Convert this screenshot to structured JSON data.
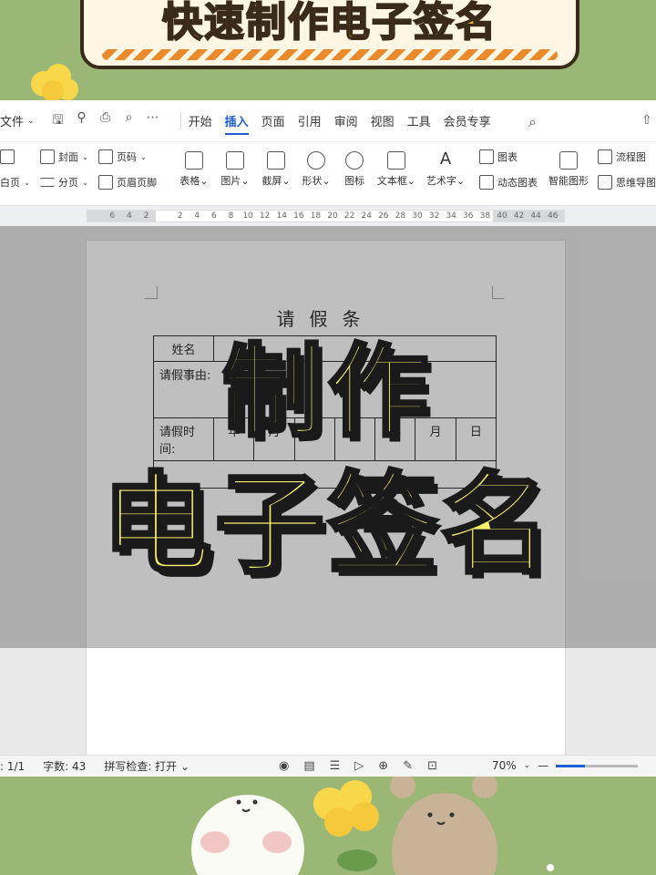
{
  "banner": {
    "title": "快速制作电子签名"
  },
  "menubar": {
    "file_label": "文件",
    "tabs": [
      {
        "label": "开始"
      },
      {
        "label": "插入"
      },
      {
        "label": "页面"
      },
      {
        "label": "引用"
      },
      {
        "label": "审阅"
      },
      {
        "label": "视图"
      },
      {
        "label": "工具"
      },
      {
        "label": "会员专享"
      }
    ],
    "active_tab": "插入"
  },
  "ribbon": {
    "blank_page": "白页",
    "cover": "封面",
    "page_break": "分页",
    "page_number": "页码",
    "header_footer": "页眉页脚",
    "table": "表格",
    "picture": "图片",
    "screenshot": "截屏",
    "shape": "形状",
    "icon": "图标",
    "textbox": "文本框",
    "wordart": "艺术字",
    "chart": "图表",
    "dynamic_chart": "动态图表",
    "smart_graphic": "智能图形",
    "flowchart": "流程图",
    "mindmap": "思维导图"
  },
  "ruler": {
    "numbers": [
      "6",
      "4",
      "2",
      "",
      "2",
      "4",
      "6",
      "8",
      "10",
      "12",
      "14",
      "16",
      "18",
      "20",
      "22",
      "24",
      "26",
      "28",
      "30",
      "32",
      "34",
      "36",
      "38",
      "40",
      "42",
      "44",
      "46"
    ]
  },
  "document": {
    "title": "请假条",
    "name_label": "姓名",
    "reason_label": "请假事由:",
    "time_label": "请假时间:",
    "date_units": [
      "年",
      "月",
      "日",
      "至",
      "年",
      "月",
      "日"
    ]
  },
  "statusbar": {
    "page": "1/1",
    "word_count": "字数: 43",
    "spell_check": "拼写检查: 打开",
    "zoom": "70%",
    "zoom_fraction": 0.35
  },
  "overlay": {
    "line1": "制作",
    "line2": "电子签名"
  }
}
